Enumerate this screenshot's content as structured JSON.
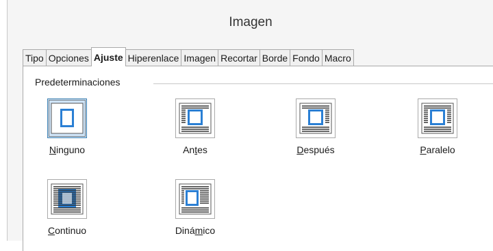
{
  "window": {
    "title": "Imagen"
  },
  "tabs": [
    {
      "label": "Tipo",
      "active": false
    },
    {
      "label": "Opciones",
      "active": false
    },
    {
      "label": "Ajuste",
      "active": true
    },
    {
      "label": "Hiperenlace",
      "active": false
    },
    {
      "label": "Imagen",
      "active": false
    },
    {
      "label": "Recortar",
      "active": false
    },
    {
      "label": "Borde",
      "active": false
    },
    {
      "label": "Fondo",
      "active": false
    },
    {
      "label": "Macro",
      "active": false
    }
  ],
  "presets": {
    "group_label": "Predeterminaciones",
    "options": [
      {
        "key": "ninguno",
        "label": "Ninguno",
        "mnemonic_index": 0,
        "icon": "wrap-none-icon",
        "selected": true
      },
      {
        "key": "antes",
        "label": "Antes",
        "mnemonic_index": 2,
        "icon": "wrap-before-icon",
        "selected": false
      },
      {
        "key": "despues",
        "label": "Después",
        "mnemonic_index": 0,
        "icon": "wrap-after-icon",
        "selected": false
      },
      {
        "key": "paralelo",
        "label": "Paralelo",
        "mnemonic_index": 0,
        "icon": "wrap-parallel-icon",
        "selected": false
      },
      {
        "key": "continuo",
        "label": "Continuo",
        "mnemonic_index": 0,
        "icon": "wrap-through-icon",
        "selected": false
      },
      {
        "key": "dinamico",
        "label": "Dinámico",
        "mnemonic_index": 4,
        "icon": "wrap-optimal-icon",
        "selected": false
      }
    ]
  },
  "colors": {
    "accent_blue": "#2a7fd4",
    "selected_bg": "#cfe4f7",
    "selected_border": "#3c7fb1"
  }
}
